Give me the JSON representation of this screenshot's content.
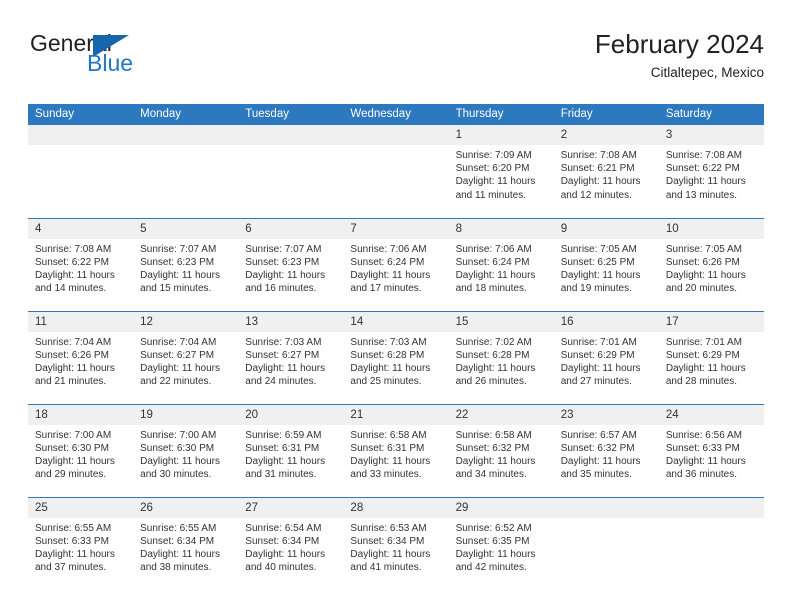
{
  "logo": {
    "word1": "General",
    "word2": "Blue",
    "triangle_icon": "triangle-icon",
    "brand_color": "#1f76c2"
  },
  "header": {
    "title": "February 2024",
    "subtitle": "Citlaltepec, Mexico"
  },
  "theme": {
    "header_bg": "#2c79bf",
    "daynum_bg": "#f0f0f0",
    "text": "#333333"
  },
  "weekdays": [
    "Sunday",
    "Monday",
    "Tuesday",
    "Wednesday",
    "Thursday",
    "Friday",
    "Saturday"
  ],
  "weeks": [
    [
      {
        "day": "",
        "sunrise": "",
        "sunset": "",
        "daylight1": "",
        "daylight2": ""
      },
      {
        "day": "",
        "sunrise": "",
        "sunset": "",
        "daylight1": "",
        "daylight2": ""
      },
      {
        "day": "",
        "sunrise": "",
        "sunset": "",
        "daylight1": "",
        "daylight2": ""
      },
      {
        "day": "",
        "sunrise": "",
        "sunset": "",
        "daylight1": "",
        "daylight2": ""
      },
      {
        "day": "1",
        "sunrise": "Sunrise: 7:09 AM",
        "sunset": "Sunset: 6:20 PM",
        "daylight1": "Daylight: 11 hours",
        "daylight2": "and 11 minutes."
      },
      {
        "day": "2",
        "sunrise": "Sunrise: 7:08 AM",
        "sunset": "Sunset: 6:21 PM",
        "daylight1": "Daylight: 11 hours",
        "daylight2": "and 12 minutes."
      },
      {
        "day": "3",
        "sunrise": "Sunrise: 7:08 AM",
        "sunset": "Sunset: 6:22 PM",
        "daylight1": "Daylight: 11 hours",
        "daylight2": "and 13 minutes."
      }
    ],
    [
      {
        "day": "4",
        "sunrise": "Sunrise: 7:08 AM",
        "sunset": "Sunset: 6:22 PM",
        "daylight1": "Daylight: 11 hours",
        "daylight2": "and 14 minutes."
      },
      {
        "day": "5",
        "sunrise": "Sunrise: 7:07 AM",
        "sunset": "Sunset: 6:23 PM",
        "daylight1": "Daylight: 11 hours",
        "daylight2": "and 15 minutes."
      },
      {
        "day": "6",
        "sunrise": "Sunrise: 7:07 AM",
        "sunset": "Sunset: 6:23 PM",
        "daylight1": "Daylight: 11 hours",
        "daylight2": "and 16 minutes."
      },
      {
        "day": "7",
        "sunrise": "Sunrise: 7:06 AM",
        "sunset": "Sunset: 6:24 PM",
        "daylight1": "Daylight: 11 hours",
        "daylight2": "and 17 minutes."
      },
      {
        "day": "8",
        "sunrise": "Sunrise: 7:06 AM",
        "sunset": "Sunset: 6:24 PM",
        "daylight1": "Daylight: 11 hours",
        "daylight2": "and 18 minutes."
      },
      {
        "day": "9",
        "sunrise": "Sunrise: 7:05 AM",
        "sunset": "Sunset: 6:25 PM",
        "daylight1": "Daylight: 11 hours",
        "daylight2": "and 19 minutes."
      },
      {
        "day": "10",
        "sunrise": "Sunrise: 7:05 AM",
        "sunset": "Sunset: 6:26 PM",
        "daylight1": "Daylight: 11 hours",
        "daylight2": "and 20 minutes."
      }
    ],
    [
      {
        "day": "11",
        "sunrise": "Sunrise: 7:04 AM",
        "sunset": "Sunset: 6:26 PM",
        "daylight1": "Daylight: 11 hours",
        "daylight2": "and 21 minutes."
      },
      {
        "day": "12",
        "sunrise": "Sunrise: 7:04 AM",
        "sunset": "Sunset: 6:27 PM",
        "daylight1": "Daylight: 11 hours",
        "daylight2": "and 22 minutes."
      },
      {
        "day": "13",
        "sunrise": "Sunrise: 7:03 AM",
        "sunset": "Sunset: 6:27 PM",
        "daylight1": "Daylight: 11 hours",
        "daylight2": "and 24 minutes."
      },
      {
        "day": "14",
        "sunrise": "Sunrise: 7:03 AM",
        "sunset": "Sunset: 6:28 PM",
        "daylight1": "Daylight: 11 hours",
        "daylight2": "and 25 minutes."
      },
      {
        "day": "15",
        "sunrise": "Sunrise: 7:02 AM",
        "sunset": "Sunset: 6:28 PM",
        "daylight1": "Daylight: 11 hours",
        "daylight2": "and 26 minutes."
      },
      {
        "day": "16",
        "sunrise": "Sunrise: 7:01 AM",
        "sunset": "Sunset: 6:29 PM",
        "daylight1": "Daylight: 11 hours",
        "daylight2": "and 27 minutes."
      },
      {
        "day": "17",
        "sunrise": "Sunrise: 7:01 AM",
        "sunset": "Sunset: 6:29 PM",
        "daylight1": "Daylight: 11 hours",
        "daylight2": "and 28 minutes."
      }
    ],
    [
      {
        "day": "18",
        "sunrise": "Sunrise: 7:00 AM",
        "sunset": "Sunset: 6:30 PM",
        "daylight1": "Daylight: 11 hours",
        "daylight2": "and 29 minutes."
      },
      {
        "day": "19",
        "sunrise": "Sunrise: 7:00 AM",
        "sunset": "Sunset: 6:30 PM",
        "daylight1": "Daylight: 11 hours",
        "daylight2": "and 30 minutes."
      },
      {
        "day": "20",
        "sunrise": "Sunrise: 6:59 AM",
        "sunset": "Sunset: 6:31 PM",
        "daylight1": "Daylight: 11 hours",
        "daylight2": "and 31 minutes."
      },
      {
        "day": "21",
        "sunrise": "Sunrise: 6:58 AM",
        "sunset": "Sunset: 6:31 PM",
        "daylight1": "Daylight: 11 hours",
        "daylight2": "and 33 minutes."
      },
      {
        "day": "22",
        "sunrise": "Sunrise: 6:58 AM",
        "sunset": "Sunset: 6:32 PM",
        "daylight1": "Daylight: 11 hours",
        "daylight2": "and 34 minutes."
      },
      {
        "day": "23",
        "sunrise": "Sunrise: 6:57 AM",
        "sunset": "Sunset: 6:32 PM",
        "daylight1": "Daylight: 11 hours",
        "daylight2": "and 35 minutes."
      },
      {
        "day": "24",
        "sunrise": "Sunrise: 6:56 AM",
        "sunset": "Sunset: 6:33 PM",
        "daylight1": "Daylight: 11 hours",
        "daylight2": "and 36 minutes."
      }
    ],
    [
      {
        "day": "25",
        "sunrise": "Sunrise: 6:55 AM",
        "sunset": "Sunset: 6:33 PM",
        "daylight1": "Daylight: 11 hours",
        "daylight2": "and 37 minutes."
      },
      {
        "day": "26",
        "sunrise": "Sunrise: 6:55 AM",
        "sunset": "Sunset: 6:34 PM",
        "daylight1": "Daylight: 11 hours",
        "daylight2": "and 38 minutes."
      },
      {
        "day": "27",
        "sunrise": "Sunrise: 6:54 AM",
        "sunset": "Sunset: 6:34 PM",
        "daylight1": "Daylight: 11 hours",
        "daylight2": "and 40 minutes."
      },
      {
        "day": "28",
        "sunrise": "Sunrise: 6:53 AM",
        "sunset": "Sunset: 6:34 PM",
        "daylight1": "Daylight: 11 hours",
        "daylight2": "and 41 minutes."
      },
      {
        "day": "29",
        "sunrise": "Sunrise: 6:52 AM",
        "sunset": "Sunset: 6:35 PM",
        "daylight1": "Daylight: 11 hours",
        "daylight2": "and 42 minutes."
      },
      {
        "day": "",
        "sunrise": "",
        "sunset": "",
        "daylight1": "",
        "daylight2": ""
      },
      {
        "day": "",
        "sunrise": "",
        "sunset": "",
        "daylight1": "",
        "daylight2": ""
      }
    ]
  ]
}
